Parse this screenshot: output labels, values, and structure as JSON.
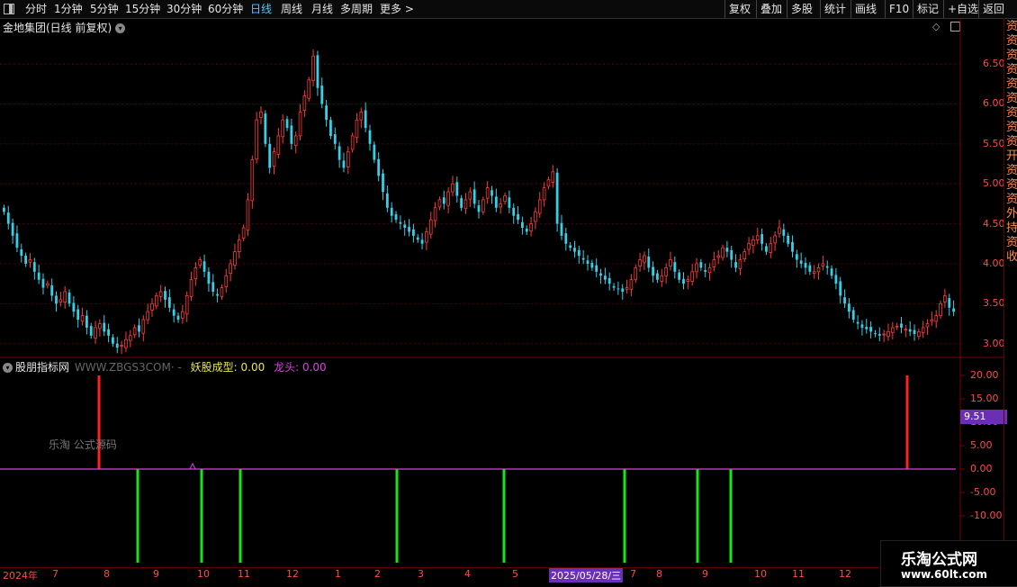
{
  "topbar": {
    "periods": [
      "分时",
      "1分钟",
      "5分钟",
      "15分钟",
      "30分钟",
      "60分钟",
      "日线",
      "周线",
      "月线",
      "多周期",
      "更多 >"
    ],
    "active_period": "日线",
    "right_buttons": [
      "复权",
      "叠加",
      "多股",
      "统计",
      "画线",
      "F10",
      "标记",
      "+自选",
      "返回"
    ]
  },
  "main_chart": {
    "title": "金地集团(日线 前复权)",
    "price_ticks": [
      "6.50",
      "6.00",
      "5.50",
      "5.00",
      "4.50",
      "4.00",
      "3.50",
      "3.00"
    ],
    "colors": {
      "up": "#ff3b3b",
      "down": "#35d0e8",
      "grid": "#5a0000"
    }
  },
  "indicator": {
    "name": "股朋指标网",
    "site": "WWW.ZBGS3COM",
    "tail": "·  -",
    "label1": "妖股成型",
    "value1": "0.00",
    "label2": "龙头",
    "value2": "0.00",
    "ticks": [
      "20.00",
      "15.00",
      "10.00",
      "5.00",
      "0.00",
      "-5.00",
      "-10.00"
    ],
    "current_value": "9.51",
    "watermark": "乐淘 公式源码",
    "colors": {
      "red": "#ff2020",
      "green": "#19e619",
      "line": "#e040e0"
    }
  },
  "date_axis": {
    "labels": [
      "2024年",
      "7",
      "8",
      "9",
      "10",
      "11",
      "12",
      "1",
      "2",
      "3",
      "4",
      "5",
      "2025/05/28/三",
      "7",
      "8",
      "9",
      "10",
      "11",
      "12"
    ],
    "highlight": "2025/05/28/三"
  },
  "sidebar_text": "资资资资资资资资资开资资资外持资收",
  "brand": {
    "name": "乐淘公式网",
    "url": "www.60lt.com"
  },
  "chart_data": {
    "type": "candlestick",
    "title": "金地集团(日线 前复权)",
    "ylim": [
      2.85,
      6.85
    ],
    "closes": [
      4.65,
      4.5,
      4.35,
      4.2,
      4.1,
      4.0,
      4.05,
      3.9,
      3.8,
      3.7,
      3.75,
      3.6,
      3.5,
      3.55,
      3.65,
      3.5,
      3.4,
      3.3,
      3.35,
      3.2,
      3.1,
      3.2,
      3.25,
      3.15,
      3.1,
      3.0,
      2.95,
      2.98,
      3.05,
      3.1,
      3.2,
      3.15,
      3.3,
      3.4,
      3.5,
      3.6,
      3.65,
      3.55,
      3.45,
      3.35,
      3.3,
      3.4,
      3.6,
      3.8,
      3.95,
      4.05,
      3.9,
      3.75,
      3.65,
      3.6,
      3.7,
      3.85,
      4.0,
      4.15,
      4.3,
      4.45,
      4.8,
      5.3,
      5.8,
      5.9,
      5.5,
      5.2,
      5.4,
      5.6,
      5.8,
      5.7,
      5.5,
      5.6,
      5.9,
      6.1,
      6.3,
      6.6,
      6.2,
      6.0,
      5.8,
      5.6,
      5.5,
      5.3,
      5.2,
      5.4,
      5.6,
      5.8,
      5.9,
      5.7,
      5.5,
      5.3,
      5.1,
      4.9,
      4.7,
      4.6,
      4.55,
      4.5,
      4.45,
      4.4,
      4.35,
      4.3,
      4.25,
      4.4,
      4.55,
      4.7,
      4.8,
      4.75,
      4.9,
      5.0,
      4.85,
      4.7,
      4.8,
      4.9,
      4.75,
      4.65,
      4.8,
      4.95,
      4.85,
      4.7,
      4.75,
      4.85,
      4.7,
      4.6,
      4.55,
      4.45,
      4.4,
      4.5,
      4.65,
      4.8,
      4.95,
      5.05,
      5.15,
      4.5,
      4.35,
      4.25,
      4.2,
      4.15,
      4.1,
      4.05,
      4.0,
      3.95,
      3.9,
      3.85,
      3.8,
      3.75,
      3.7,
      3.68,
      3.65,
      3.7,
      3.8,
      3.95,
      4.05,
      4.1,
      3.95,
      3.85,
      3.8,
      3.85,
      3.95,
      4.05,
      3.9,
      3.8,
      3.75,
      3.8,
      3.9,
      4.0,
      3.95,
      3.9,
      3.95,
      4.05,
      4.1,
      4.2,
      4.15,
      4.05,
      3.95,
      4.05,
      4.15,
      4.25,
      4.3,
      4.35,
      4.25,
      4.15,
      4.25,
      4.35,
      4.45,
      4.35,
      4.25,
      4.15,
      4.05,
      4.0,
      3.95,
      3.9,
      3.9,
      3.95,
      4.0,
      3.95,
      3.85,
      3.75,
      3.6,
      3.5,
      3.4,
      3.3,
      3.25,
      3.2,
      3.18,
      3.15,
      3.12,
      3.1,
      3.12,
      3.15,
      3.2,
      3.22,
      3.2,
      3.18,
      3.15,
      3.12,
      3.15,
      3.2,
      3.25,
      3.3,
      3.35,
      3.5,
      3.6,
      3.45,
      3.4
    ]
  }
}
